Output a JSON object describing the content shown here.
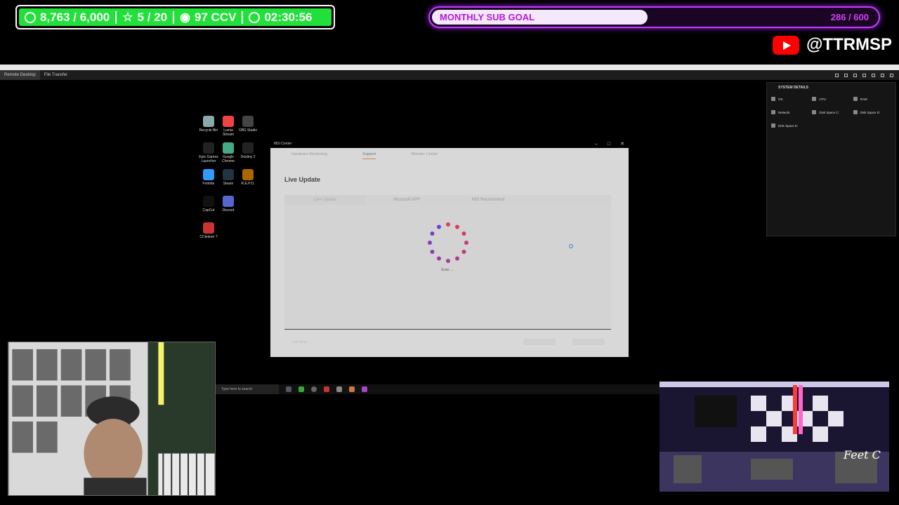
{
  "stream_stats": {
    "followers": "8,763 / 6,000",
    "subs": "5 / 20",
    "viewers": "97 CCV",
    "uptime": "02:30:56"
  },
  "sub_goal": {
    "label": "MONTHLY SUB GOAL",
    "count": "286 / 600",
    "progress": 0.477
  },
  "youtube": {
    "handle": "@TTRMSP"
  },
  "remote_desktop": {
    "tabs": [
      "Remote Desktop",
      "File Transfer"
    ]
  },
  "desktop_icons": [
    {
      "label": "Recycle Bin"
    },
    {
      "label": "Lumia Stream"
    },
    {
      "label": "OBS Studio"
    },
    {
      "label": "Epic Games Launcher"
    },
    {
      "label": "Google Chrome"
    },
    {
      "label": "Destiny 2"
    },
    {
      "label": "Fortnite"
    },
    {
      "label": "Steam"
    },
    {
      "label": "R.E.P.O."
    },
    {
      "label": "CapCut"
    },
    {
      "label": "Discord"
    },
    {
      "label": "CCleaner 7"
    }
  ],
  "system_details": {
    "title": "SYSTEM DETAILS",
    "cells": [
      {
        "head": "OS"
      },
      {
        "head": "CPU"
      },
      {
        "head": "RAM"
      },
      {
        "head": "Network"
      },
      {
        "head": "Disk Space C:"
      },
      {
        "head": "Disk Space D:"
      },
      {
        "head": "Disk Space E:"
      }
    ]
  },
  "msi_center": {
    "window_title": "MSI Center",
    "nav": [
      "Hardware Monitoring",
      "Support",
      "Monster Center"
    ],
    "page_title": "Live Update",
    "subtabs": [
      "Live Update",
      "Microsoft APP",
      "MSI Recommend"
    ],
    "scan_label": "Scan ...",
    "footer_label": "Last Scan"
  },
  "taskbar": {
    "search_placeholder": "Type here to search"
  },
  "colors": {
    "stats_green": "#22e03a",
    "goal_purple": "#c43cff",
    "youtube_red": "#ff0000"
  }
}
